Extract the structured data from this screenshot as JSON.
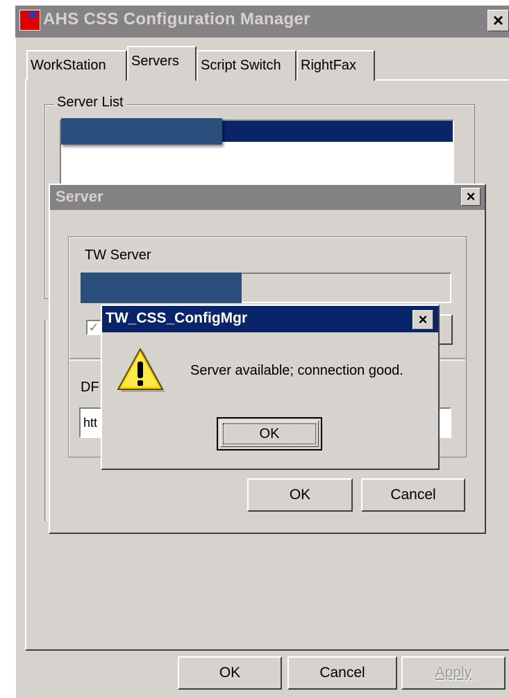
{
  "window": {
    "title": "AHS CSS Configuration Manager",
    "close_glyph": "×"
  },
  "tabs": [
    {
      "label": "WorkStation"
    },
    {
      "label": "Servers",
      "selected": true
    },
    {
      "label": "Script Switch"
    },
    {
      "label": "RightFax"
    }
  ],
  "server_list": {
    "label": "Server List"
  },
  "server_dialog": {
    "title": "Server",
    "close_glyph": "×",
    "group_label": "TW Server",
    "checkbox_glyph": "✓",
    "df_label": "DF",
    "df_value": "htt",
    "ok_label": "OK",
    "cancel_label": "Cancel"
  },
  "message_box": {
    "title": "TW_CSS_ConfigMgr",
    "close_glyph": "×",
    "icon": "warning-icon",
    "message": "Server available; connection good.",
    "ok_label": "OK"
  },
  "buttons": {
    "ok_label": "OK",
    "cancel_label": "Cancel",
    "apply_label": "Apply"
  },
  "colors": {
    "window_bg": "#d6d3ce",
    "inactive_title": "#848284",
    "active_title": "#0a246a",
    "redaction": "#2a4f7c"
  }
}
